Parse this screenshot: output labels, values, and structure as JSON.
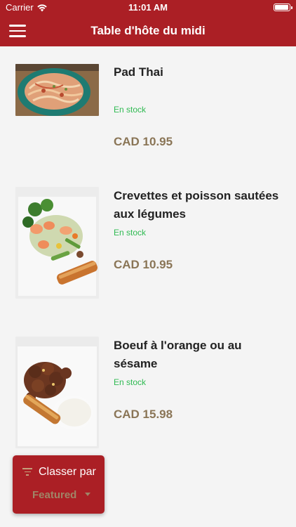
{
  "status_bar": {
    "carrier": "Carrier",
    "time": "11:01 AM",
    "wifi_icon": "wifi-icon",
    "battery_icon": "battery-icon",
    "battery_level": 1.0
  },
  "nav": {
    "title": "Table d'hôte du midi",
    "menu_icon": "hamburger-menu-icon"
  },
  "products": [
    {
      "name": "Pad Thai",
      "stock": "En stock",
      "price": "CAD 10.95",
      "image": "pad-thai-noodles"
    },
    {
      "name": "Crevettes et poisson sautées aux légumes",
      "stock": "En stock",
      "price": "CAD 10.95",
      "image": "shrimp-fish-vegetables-eggroll"
    },
    {
      "name": "Boeuf à l'orange ou au sésame",
      "stock": "En stock",
      "price": "CAD 15.98",
      "image": "orange-beef-rice-eggroll"
    }
  ],
  "sort": {
    "label": "Classer par",
    "value": "Featured",
    "icon": "filter-icon",
    "dropdown_icon": "chevron-down-icon"
  },
  "colors": {
    "brand_red": "#ab1f25",
    "stock_green": "#2fba52",
    "price_brown": "#8a7556",
    "background": "#f4f4f4"
  }
}
